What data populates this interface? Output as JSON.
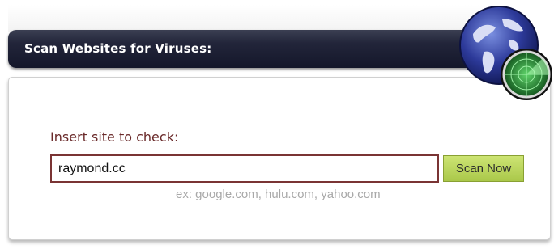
{
  "header": {
    "title": "Scan Websites for Viruses:"
  },
  "form": {
    "label": "Insert site to check:",
    "input_value": "raymond.cc",
    "button_label": "Scan Now",
    "example": "ex: google.com, hulu.com, yahoo.com"
  },
  "icons": {
    "logo": "globe-radar-icon"
  },
  "colors": {
    "header_bg": "#1c1f33",
    "label_text": "#6a2a2a",
    "input_border": "#7a3434",
    "button_bg": "#bcd85c"
  }
}
